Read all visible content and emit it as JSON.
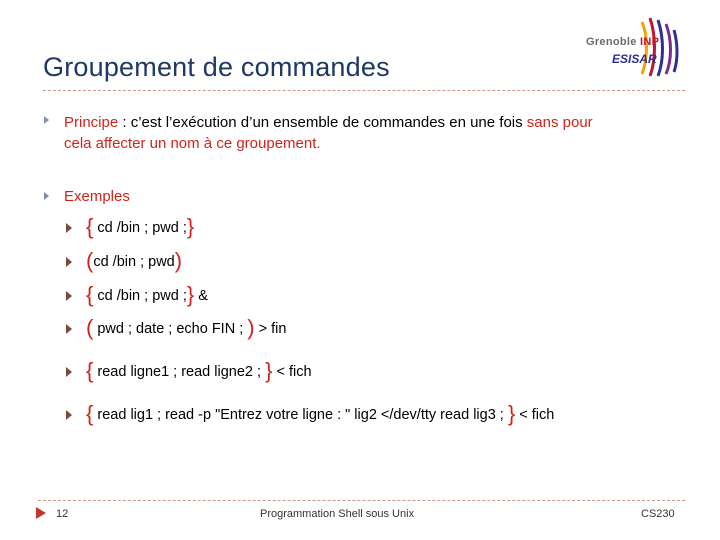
{
  "title": "Groupement de commandes",
  "logo": {
    "top_text": "Grenoble",
    "inp_text": "INP",
    "bottom_text": "ESISAR"
  },
  "principe": {
    "label": "Principe",
    "colon": " :  ",
    "text": "c’est l’exécution d’un ensemble de commandes en une fois ",
    "red_part1": "sans pour",
    "red_part2": "cela affecter un nom à ce groupement."
  },
  "exemples_label": "Exemples",
  "examples": [
    {
      "open": "{",
      "cmd": " cd /bin ; pwd ;",
      "close": "}",
      "after": ""
    },
    {
      "open": "(",
      "cmd": "cd /bin ; pwd",
      "close": ")",
      "after": ""
    },
    {
      "open": "{",
      "cmd": " cd /bin ; pwd ;",
      "close": "}",
      "after": " &"
    },
    {
      "open": "(",
      "cmd": " pwd ; date ; echo FIN ; ",
      "close": ")",
      "after": " > fin"
    },
    {
      "open": "{",
      "cmd": " read ligne1 ; read ligne2 ; ",
      "close": "}",
      "after": " < fich"
    },
    {
      "open": "{",
      "cmd": " read lig1 ; read -p \"Entrez votre ligne : \" lig2 </dev/tty  read lig3 ;  ",
      "close": "}",
      "after": "  < fich"
    }
  ],
  "footer": {
    "page": "12",
    "center": "Programmation Shell sous Unix",
    "right": "CS230"
  },
  "colors": {
    "title": "#1f3864",
    "accent_red": "#d0241b",
    "footer_triangle": "#c0392b"
  }
}
